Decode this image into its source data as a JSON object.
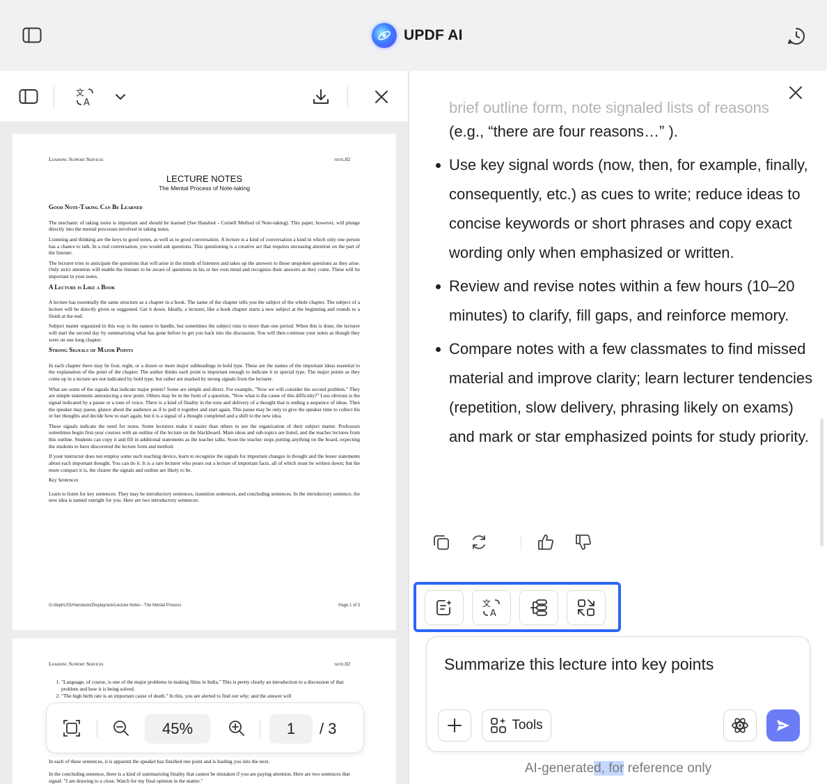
{
  "app": {
    "title": "UPDF AI"
  },
  "pdf_viewer": {
    "zoom": "45%",
    "current_page": "1",
    "total_pages": "/ 3",
    "page1": {
      "header_left": "Learning Support Services",
      "header_right": "note.02",
      "title": "LECTURE NOTES",
      "subtitle": "The Mental Process of Note-taking",
      "sections": [
        {
          "heading": "Good Note-Taking Can Be Learned",
          "paragraphs": [
            "The mechanic of taking notes is important and should be learned (See Handout - Cornell Method of Note-taking). This paper, however, will plunge directly into the mental processes involved in taking notes.",
            "Listening and thinking are the keys to good notes, as well as to good conversation. A lecture is a kind of conversation a kind in which only one person has a chance to talk. In a real conversation, you would ask questions. This questioning is a creative act that requires unceasing attention on the part of the listener.",
            "The lecturer tries to anticipate the questions that will arise in the minds of listeners and takes up the answers to those unspoken questions as they arise. Only strict attention will enable the listener to be aware of questions in his or her own mind and recognize their answers as they come. These will be important in your notes."
          ]
        },
        {
          "heading": "A Lecture is Like a Book",
          "paragraphs": [
            "A lecture has essentially the same structure as a chapter in a book. The name of the chapter tells you the subject of the whole chapter. The subject of a lecture will be directly given or suggested. Get it down. Ideally, a lecturer, like a book chapter starts a new subject at the beginning and rounds to a finish at the end.",
            "Subject matter organized in this way is the easiest to handle, but sometimes the subject runs to more than one period. When this is done, the lecturer will start the second day by summarizing what has gone before to get you back into the discussion. You will then continue your notes as though they were on one long chapter."
          ]
        },
        {
          "heading": "Strong Signals of Major Points",
          "paragraphs": [
            "In each chapter there may be four, eight, or a dozen or more major subheadings in bold type. These are the names of the important ideas essential to the explanation of the point of the chapter. The author thinks each point is important enough to indicate it in special type. The major points as they come up in a lecture are not indicated by bold type, but rather are marked by strong signals from the lecturer.",
            "What are some of the signals that indicate major points? Some are simple and direct. For example, \"Now we will consider the second problem.\" They are simple statements announcing a new point. Others may be in the form of a question, \"Now what is the cause of this difficulty?\" Less obvious is the signal indicated by a pause or a tone of voice. There is a kind of finality in the tone and delivery of a thought that is ending a sequence of ideas. Then the speaker may pause, glance about the audience as if to pull it together and start again. This pause may be only to give the speaker time to collect his or her thoughts and decide how to start again, but it is a signal of a thought completed and a shift to the new idea.",
            "These signals indicate the need for notes. Some lecturers make it easier than others to see the organization of their subject matter. Professors sometimes begin first-year courses with an outline of the lecture on the blackboard. Main ideas and sub-topics are listed, and the teacher lectures from this outline. Students can copy it and fill in additional statements as the teacher talks. Soon the teacher stops putting anything on the board, expecting the students to have discovered the lecture form and method.",
            "If your instructor does not employ some such teaching device, learn to recognize the signals for important changes in thought and the lesser statements about each important thought. You can do it. It is a rare lecturer who pours out a lecture of important facts, all of which must be written down; but the more compact it is, the clearer the signals and outline are likely to be."
          ]
        }
      ],
      "italic_heading": "Key Sentences",
      "closing_paragraph": "Learn to listen for key sentences. They may be introductory sentences, transition sentences, and concluding sentences. In the introductory sentence, the new idea is named outright for you. Here are two introductory sentences:",
      "footer_left": "O:/dept/LSS/Handouts/Displayrack/Lecture Notes - The Mental Process",
      "footer_right": "Page 1 of 3"
    },
    "page2": {
      "header_left": "Learning Support Services",
      "header_right": "note.02",
      "list": [
        "\"Language, of course, is one of the major problems in making films in India.\" This is pretty clearly an introduction to a discussion of that problem and how it is being solved.",
        "\"The high birth rate is an important cause of death.\" In this, you are alerted to find out why; and the answer will"
      ],
      "paragraphs": [
        "In each of these sentences, it is apparent the speaker has finished one point and is leading you into the next.",
        "In the concluding sentence, there is a kind of summarizing finality that cannot be mistaken if you are paying attention. Here are two sentences that signal: \"I am drawing to a close. Watch for my final opinion in the matter.\""
      ]
    }
  },
  "assistant": {
    "faded_line": "brief outline form, note signaled lists of reasons",
    "intro_line": "(e.g.,  “there are four reasons…” ).",
    "bullets": [
      "Use key signal words (now, then, for example, finally, consequently, etc.) as cues to write; reduce ideas to concise keywords or short phrases and copy exact wording only when emphasized or written.",
      "Review and revise notes within a few hours (10–20 minutes) to clarify, fill gaps, and reinforce memory.",
      "Compare notes with a few classmates to find missed material and improve clarity; learn lecturer tendencies (repetition, slow delivery, phrasing likely on exams) and mark or star emphasized points for study priority."
    ],
    "prompt_text": "Summarize this lecture into key points",
    "tools_label": "Tools",
    "disclaimer_before": "AI-generate",
    "disclaimer_selected": "d, for",
    "disclaimer_after": " reference only"
  },
  "colors": {
    "accent_blue": "#2b67f6",
    "send_button": "#6b7cf6",
    "selection": "#c4d8ff"
  },
  "icons": {
    "top_left": "sidebar-toggle-icon",
    "top_right": "history-clock-icon",
    "pdf_toolbar": [
      "panel-icon",
      "translate-icon",
      "chevron-down-icon",
      "download-icon",
      "close-icon"
    ],
    "zoom_toolbar": [
      "fit-page-icon",
      "zoom-out-icon",
      "zoom-in-icon"
    ],
    "message_actions": [
      "copy-icon",
      "regenerate-icon",
      "thumbs-up-icon",
      "thumbs-down-icon"
    ],
    "quick_actions": [
      "summarize-icon",
      "translate-icon",
      "mindmap-icon",
      "convert-icon"
    ],
    "input": [
      "plus-icon",
      "tools-icon",
      "model-atom-icon",
      "send-icon"
    ]
  }
}
